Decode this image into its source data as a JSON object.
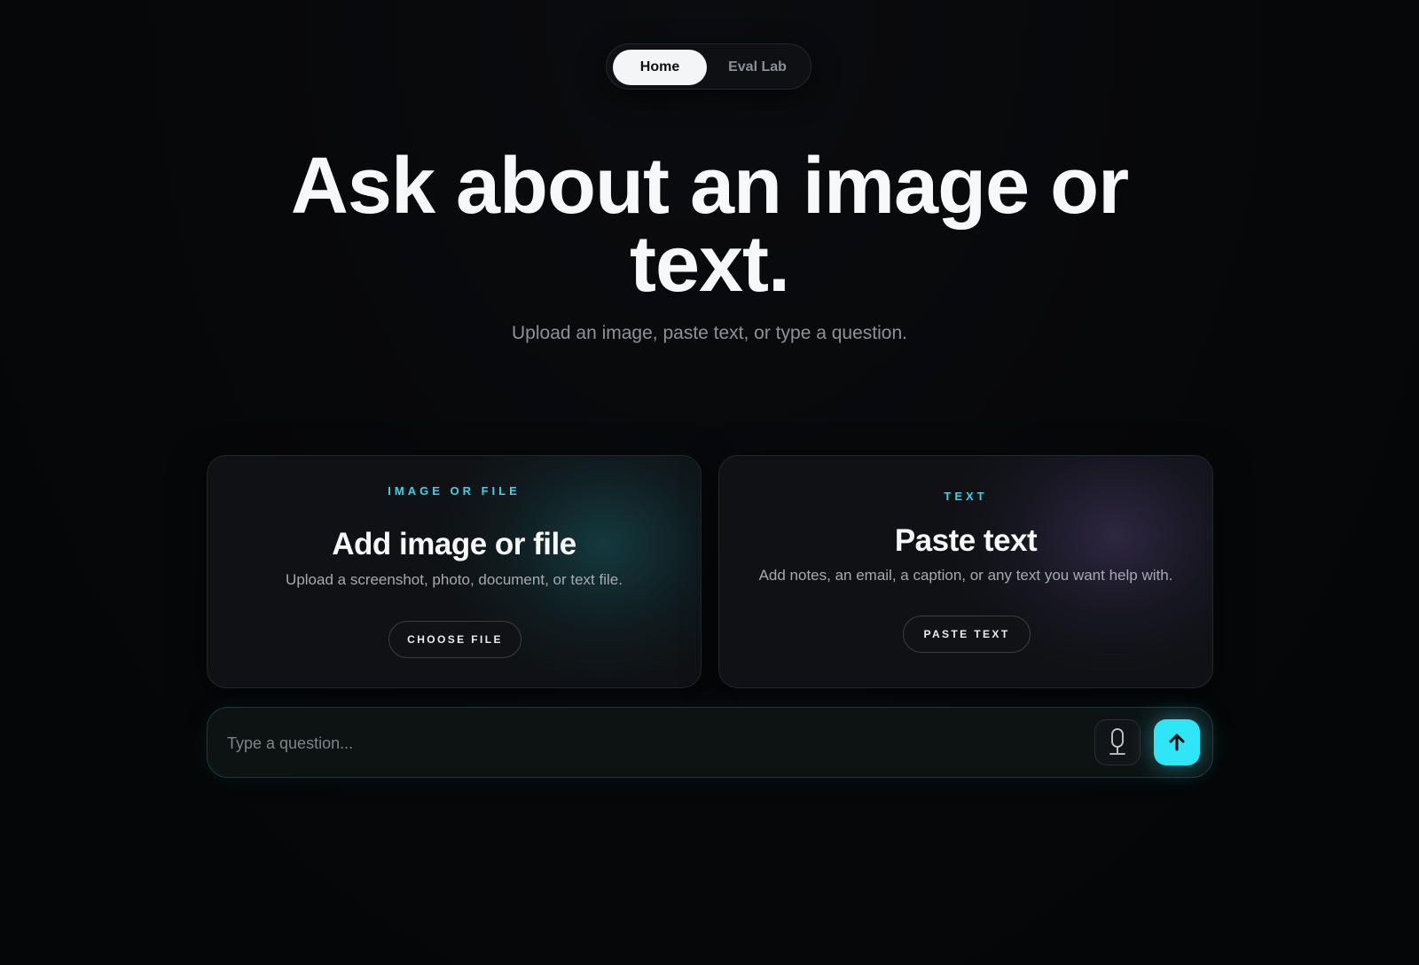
{
  "nav": {
    "tabs": [
      {
        "label": "Home",
        "active": true
      },
      {
        "label": "Eval Lab",
        "active": false
      }
    ]
  },
  "hero": {
    "title_line1": "Ask about an image or",
    "title_line2": "text.",
    "subtitle": "Upload an image, paste text, or type a question."
  },
  "cards": {
    "image": {
      "eyebrow": "IMAGE OR FILE",
      "title": "Add image or file",
      "description": "Upload a screenshot, photo, document, or text file.",
      "button": "CHOOSE FILE",
      "icon": "teal-glow"
    },
    "text": {
      "eyebrow": "TEXT",
      "title": "Paste text",
      "description": "Add notes, an email, a caption, or any text you want help with.",
      "button": "PASTE TEXT",
      "icon": "purple-glow"
    }
  },
  "composer": {
    "placeholder": "Type a question...",
    "value": "",
    "mic_icon": "microphone-icon",
    "send_icon": "arrow-up-icon"
  },
  "colors": {
    "accent": "#2ee6f5",
    "eyebrow": "#39d5e6",
    "background": "#060709"
  }
}
